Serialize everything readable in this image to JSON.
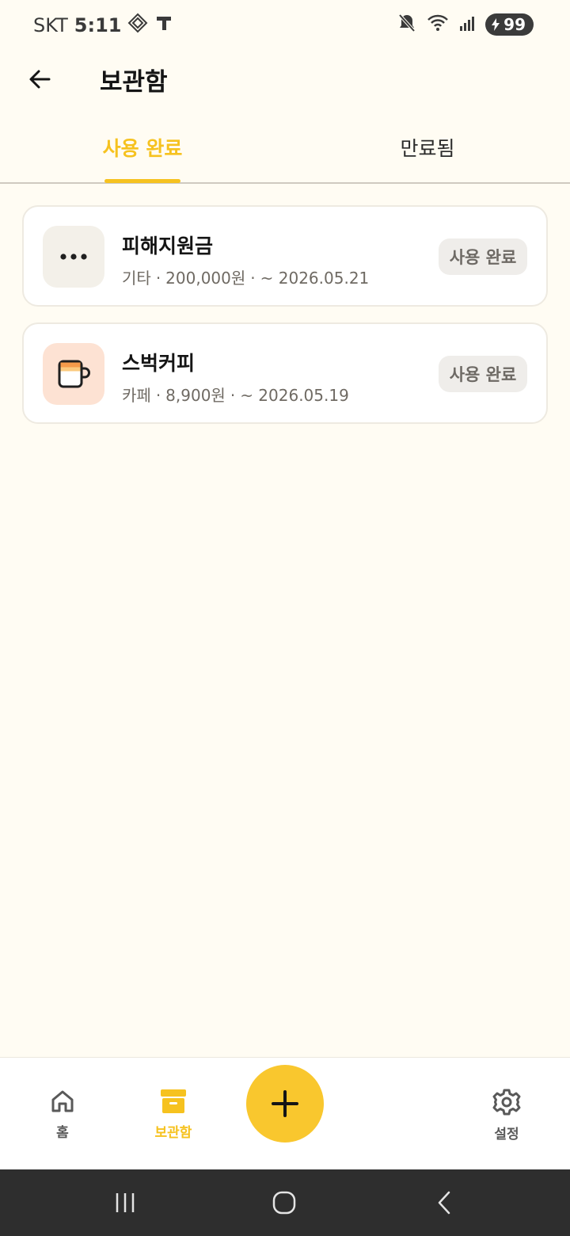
{
  "status_bar": {
    "carrier": "SKT",
    "time": "5:11",
    "battery": "99"
  },
  "header": {
    "title": "보관함"
  },
  "tabs": [
    {
      "label": "사용 완료",
      "active": true
    },
    {
      "label": "만료됨",
      "active": false
    }
  ],
  "coupons": [
    {
      "name": "피해지원금",
      "category": "기타",
      "amount": "200,000원",
      "expiry": "~ 2026.05.21",
      "status": "사용 완료",
      "icon": "more-dots-icon"
    },
    {
      "name": "스벅커피",
      "category": "카페",
      "amount": "8,900원",
      "expiry": "~ 2026.05.19",
      "status": "사용 완료",
      "icon": "coffee-mug-icon"
    }
  ],
  "meta_separator": "·",
  "bottom_nav": {
    "home": "홈",
    "archive": "보관함",
    "settings": "설정"
  },
  "colors": {
    "accent": "#F6C21F",
    "background": "#FFFCF3",
    "cafe_icon_bg": "#FDE2D3"
  }
}
